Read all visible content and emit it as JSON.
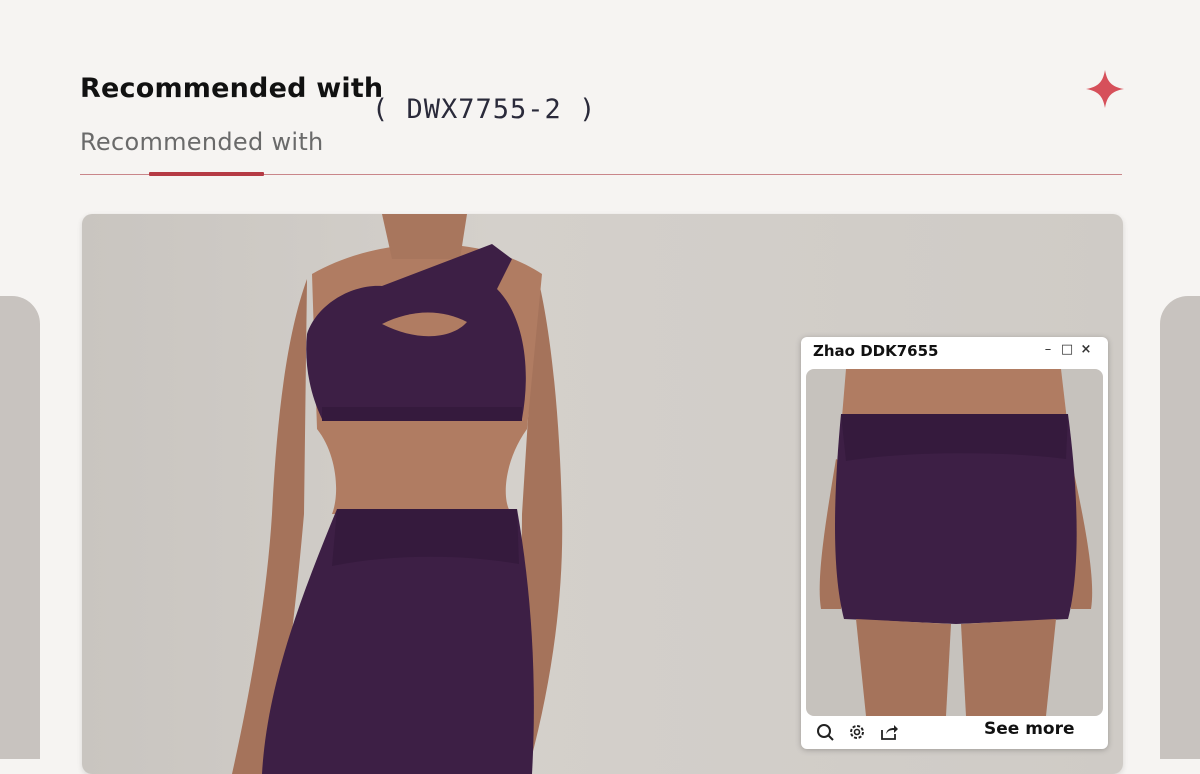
{
  "header": {
    "title": "Recommended with",
    "code": "( DWX7755-2 )",
    "subtitle": "Recommended with",
    "accent_color": "#b53a44",
    "star_icon": "four-point-star-icon"
  },
  "hero": {
    "image": "model wearing purple one-shoulder sports bra and high-waist leggings",
    "garment_color": "#3d1f45"
  },
  "popup": {
    "title": "Zhao DDK7655",
    "controls": {
      "minimize": "–",
      "maximize": "□",
      "close": "×"
    },
    "image": "model wearing purple high-waist biker shorts",
    "tools": [
      "zoom-icon",
      "settings-icon",
      "share-icon"
    ],
    "see_more_label": "See more"
  }
}
